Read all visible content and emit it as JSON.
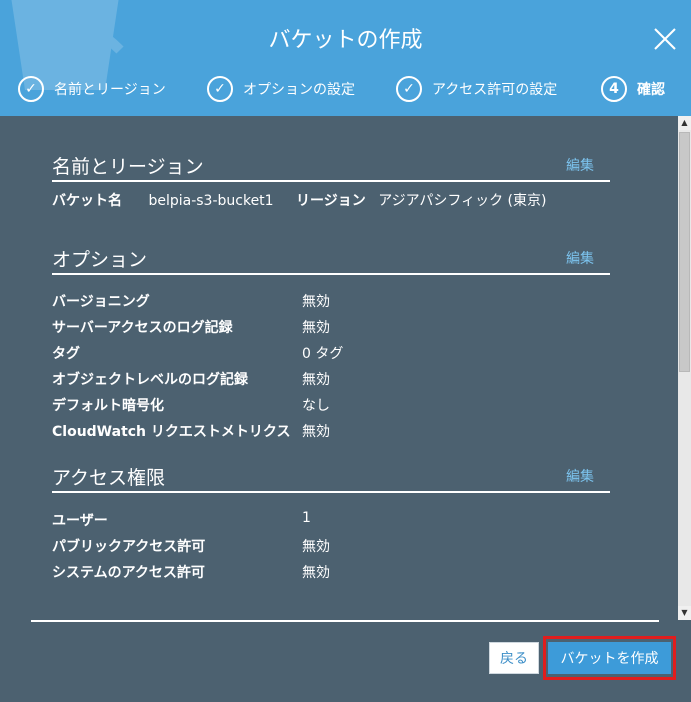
{
  "header": {
    "title": "バケットの作成",
    "close_icon": "close-icon",
    "steps": [
      {
        "label": "名前とリージョン",
        "state": "done",
        "marker": "✓"
      },
      {
        "label": "オプションの設定",
        "state": "done",
        "marker": "✓"
      },
      {
        "label": "アクセス許可の設定",
        "state": "done",
        "marker": "✓"
      },
      {
        "label": "確認",
        "state": "active",
        "marker": "4"
      }
    ]
  },
  "sections": {
    "name_region": {
      "title": "名前とリージョン",
      "edit_label": "編集",
      "bucket_name_key": "バケット名",
      "bucket_name_value": "belpia-s3-bucket1",
      "region_key": "リージョン",
      "region_value": "アジアパシフィック (東京)"
    },
    "options": {
      "title": "オプション",
      "edit_label": "編集",
      "rows": [
        {
          "key": "バージョニング",
          "value": "無効"
        },
        {
          "key": "サーバーアクセスのログ記録",
          "value": "無効"
        },
        {
          "key": "タグ",
          "value": "0 タグ"
        },
        {
          "key": "オブジェクトレベルのログ記録",
          "value": "無効"
        },
        {
          "key": "デフォルト暗号化",
          "value": "なし"
        },
        {
          "key": "CloudWatch リクエストメトリクス",
          "value": "無効"
        }
      ]
    },
    "permissions": {
      "title": "アクセス権限",
      "edit_label": "編集",
      "rows": [
        {
          "key": "ユーザー",
          "value": "1"
        },
        {
          "key": "パブリックアクセス許可",
          "value": "無効"
        },
        {
          "key": "システムのアクセス許可",
          "value": "無効"
        }
      ]
    }
  },
  "footer": {
    "back_label": "戻る",
    "create_label": "バケットを作成"
  },
  "colors": {
    "header_bg": "#4aa3db",
    "body_bg": "#4c6170",
    "link": "#7cc4ef",
    "primary_button": "#3d9bd9",
    "highlight_outline": "#e11d1d"
  }
}
